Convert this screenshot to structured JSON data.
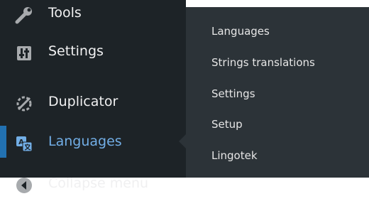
{
  "sidebar": {
    "items": [
      {
        "label": "Tools",
        "icon": "wrench-icon"
      },
      {
        "label": "Settings",
        "icon": "settings-sliders-icon"
      },
      {
        "label": "Duplicator",
        "icon": "duplicator-icon"
      },
      {
        "label": "Languages",
        "icon": "translation-icon",
        "current": true
      },
      {
        "label": "Collapse menu",
        "icon": "collapse-icon"
      }
    ]
  },
  "submenu": {
    "items": [
      {
        "label": "Languages"
      },
      {
        "label": "Strings translations"
      },
      {
        "label": "Settings"
      },
      {
        "label": "Setup"
      },
      {
        "label": "Lingotek"
      }
    ]
  },
  "colors": {
    "sidebar_bg": "#1d2327",
    "submenu_bg": "#2c3338",
    "text": "#f0f0f1",
    "accent": "#72aee6",
    "active_bar": "#2271b1"
  }
}
